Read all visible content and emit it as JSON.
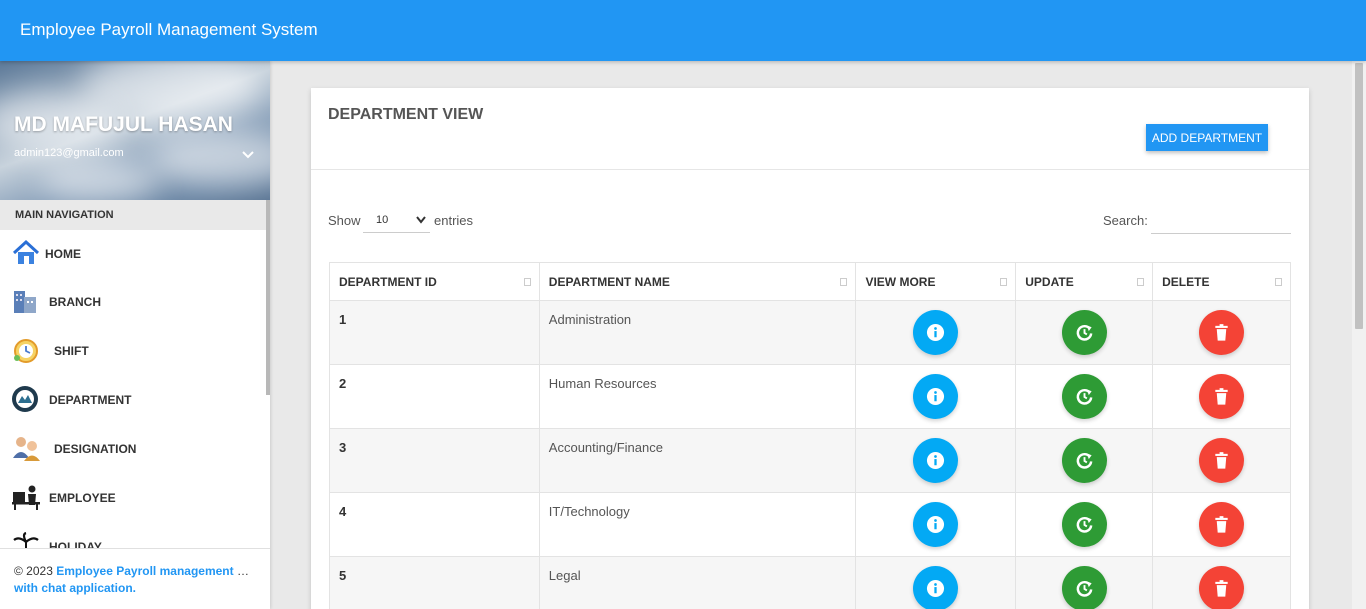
{
  "app": {
    "title": "Employee Payroll Management System"
  },
  "user": {
    "name": "MD MAFUJUL HASAN",
    "email": "admin123@gmail.com"
  },
  "sidebar": {
    "header": "MAIN NAVIGATION",
    "items": [
      {
        "label": "HOME",
        "icon": "home-icon"
      },
      {
        "label": "BRANCH",
        "icon": "building-icon"
      },
      {
        "label": "SHIFT",
        "icon": "clock-icon"
      },
      {
        "label": "DEPARTMENT",
        "icon": "department-emblem-icon"
      },
      {
        "label": "DESIGNATION",
        "icon": "people-icon"
      },
      {
        "label": "EMPLOYEE",
        "icon": "desk-worker-icon"
      },
      {
        "label": "HOLIDAY",
        "icon": "palm-tree-icon"
      }
    ]
  },
  "footer": {
    "prefix": "© 2023 ",
    "link_line1": "Employee Payroll management System",
    "link_line2": "with chat application."
  },
  "page": {
    "title": "DEPARTMENT VIEW",
    "add_button": "ADD DEPARTMENT",
    "show_label": "Show",
    "entries_value": "10",
    "entries_label": "entries",
    "search_label": "Search:"
  },
  "table": {
    "columns": [
      "DEPARTMENT ID",
      "DEPARTMENT NAME",
      "VIEW MORE",
      "UPDATE",
      "DELETE"
    ],
    "rows": [
      {
        "id": "1",
        "name": "Administration"
      },
      {
        "id": "2",
        "name": "Human Resources"
      },
      {
        "id": "3",
        "name": "Accounting/Finance"
      },
      {
        "id": "4",
        "name": "IT/Technology"
      },
      {
        "id": "5",
        "name": "Legal"
      }
    ]
  },
  "colors": {
    "primary": "#2196f3",
    "info": "#03a9f4",
    "update": "#2e9b35",
    "delete": "#f44336"
  }
}
